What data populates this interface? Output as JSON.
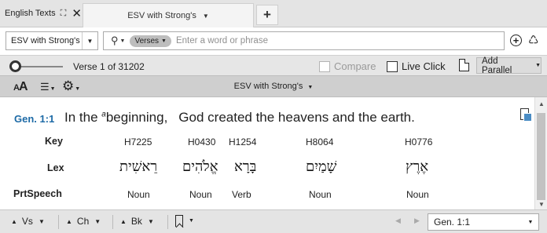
{
  "tabs": {
    "english_texts": "English Texts",
    "esv": "ESV with Strong's",
    "add": "+"
  },
  "search": {
    "version": "ESV with Strong's",
    "scope": "Verses",
    "placeholder": "Enter a word or phrase"
  },
  "nav": {
    "verse_counter": "Verse 1 of 31202",
    "compare_label": "Compare",
    "live_click_label": "Live Click",
    "add_parallel_label": "Add Parallel"
  },
  "panel": {
    "title": "ESV with Strong's",
    "font_size_label": "A"
  },
  "verse": {
    "reference": "Gen. 1:1",
    "text_part1": "In the ",
    "footnote": "a",
    "text_part2": "beginning,",
    "text_part3": "God created the heavens and the earth."
  },
  "interlinear": {
    "row_labels": [
      "Key",
      "Lex",
      "PrtSpeech"
    ],
    "columns": [
      {
        "key": "H7225",
        "lex": "רֵאשִׁית",
        "pos": "Noun"
      },
      {
        "key": "H0430",
        "lex": "אֱלֹהִים",
        "pos": "Noun"
      },
      {
        "key": "H1254",
        "lex": "בָּרָא",
        "pos": "Verb"
      },
      {
        "key": "H8064",
        "lex": "שָׁמַיִם",
        "pos": "Noun"
      },
      {
        "key": "H0776",
        "lex": "אֶרֶץ",
        "pos": "Noun"
      }
    ]
  },
  "bottom": {
    "vs": "Vs",
    "ch": "Ch",
    "bk": "Bk",
    "reference": "Gen. 1:1"
  },
  "icons": {
    "layout": "expand-icon",
    "close": "close-icon",
    "search": "magnifier-icon",
    "add": "plus-circle-icon",
    "recycle": "recycle-icon",
    "text_size": "text-size-icon",
    "list": "list-icon",
    "settings": "gear-icon",
    "document": "document-icon",
    "bookmark": "bookmark-icon"
  },
  "colors": {
    "reference": "#1d6aa6",
    "toolbar": "#cfcfcf"
  }
}
